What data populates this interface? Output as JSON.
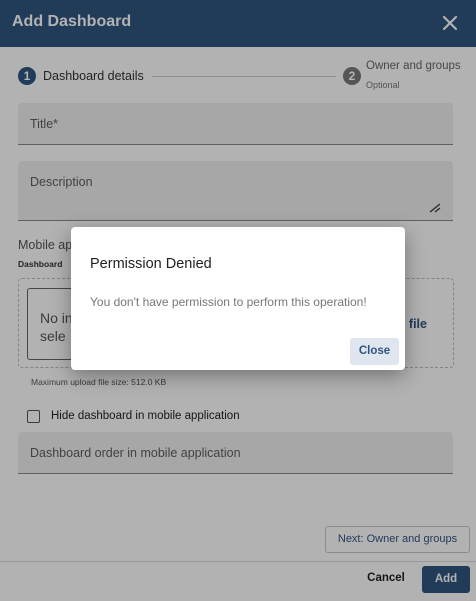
{
  "dialog": {
    "title": "Add Dashboard",
    "close_icon": "close-icon"
  },
  "stepper": {
    "step1": {
      "number": "1",
      "label": "Dashboard details"
    },
    "step2": {
      "number": "2",
      "label": "Owner and groups",
      "sublabel": "Optional"
    }
  },
  "form": {
    "title_label": "Title*",
    "description_label": "Description",
    "mobile_label": "Mobile ap",
    "mobile_sublabel": "Dashboard",
    "no_image_text": "No in\nsele",
    "browse_text": "e file",
    "max_upload": "Maximum upload file size: 512.0 KB",
    "hide_checkbox_label": "Hide dashboard in mobile application",
    "hide_checked": false,
    "order_label": "Dashboard order in mobile application"
  },
  "buttons": {
    "next": "Next: Owner and groups",
    "cancel": "Cancel",
    "add": "Add"
  },
  "modal": {
    "title": "Permission Denied",
    "message": "You don't have permission to perform this operation!",
    "close": "Close"
  },
  "colors": {
    "primary": "#305680",
    "backdrop": "rgba(0,0,0,0.30)"
  }
}
